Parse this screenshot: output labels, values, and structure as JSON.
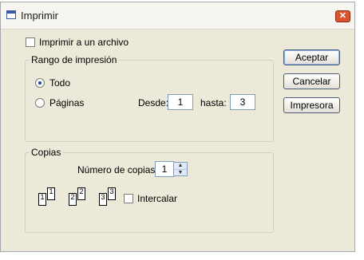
{
  "window": {
    "title": "Imprimir"
  },
  "print_to_file": {
    "label": "Imprimir a un archivo",
    "checked": false
  },
  "range": {
    "title": "Rango de impresión",
    "all_label": "Todo",
    "pages_label": "Páginas",
    "selected": "Todo",
    "from_label": "Desde:",
    "from_value": "1",
    "to_label": "hasta:",
    "to_value": "3"
  },
  "copies": {
    "title": "Copias",
    "count_label": "Número de copias:",
    "count_value": "1",
    "collate_label": "Intercalar",
    "collate_checked": false,
    "collate_pages": [
      "1",
      "1",
      "2",
      "2",
      "3",
      "3"
    ]
  },
  "buttons": {
    "accept": "Aceptar",
    "cancel": "Cancelar",
    "printer": "Impresora"
  },
  "icons": {
    "title": "window-icon",
    "close": "close-x",
    "spin_up": "▲",
    "spin_down": "▼"
  }
}
